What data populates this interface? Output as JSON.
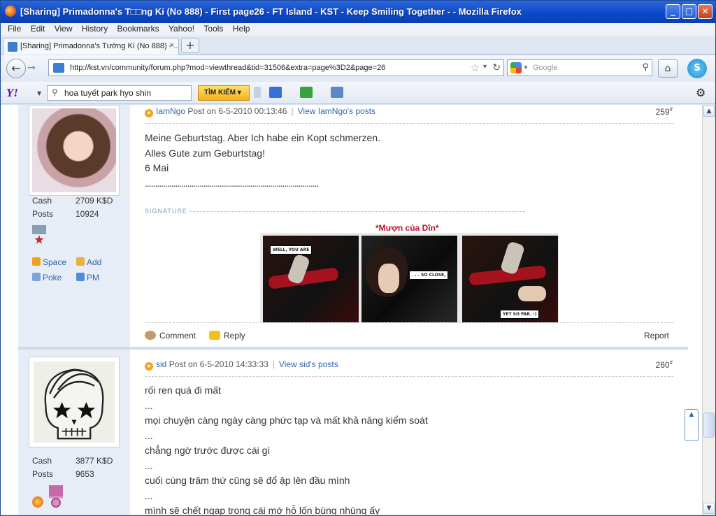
{
  "window": {
    "title": "[Sharing] Primadonna's T□□ng Kí (No 888) - First page26 - FT Island - KST - Keep Smiling Together - - Mozilla Firefox",
    "minimize": "_",
    "maximize": "□",
    "close": "✕"
  },
  "menu": [
    "File",
    "Edit",
    "View",
    "History",
    "Bookmarks",
    "Yahoo!",
    "Tools",
    "Help"
  ],
  "tab": {
    "label": "[Sharing] Primadonna's Tướng Kí (No 888) - ...",
    "close": "×"
  },
  "newtab": "+",
  "nav": {
    "url": "http://kst.vn/community/forum.php?mod=viewthread&tid=31506&extra=page%3D2&page=26",
    "search_placeholder": "Google"
  },
  "yahoo": {
    "logo": "Y!",
    "search_value": "hoa tuyết park hyo shin",
    "button": "TÌM KIẾM ▾"
  },
  "posts": [
    {
      "author": "IamNgo",
      "posted": "Post on 6-5-2010 00:13:46",
      "view_link": "View IamNgo's posts",
      "number": "259",
      "cash_label": "Cash",
      "cash": "2709 K$D",
      "posts_label": "Posts",
      "posts": "10924",
      "actions": [
        "Space",
        "Add",
        "Poke",
        "PM"
      ],
      "lines": [
        "Meine Geburtstag. Aber Ich habe ein Kopt schmerzen.",
        "Alles Gute zum Geburtstag!",
        "6 Mai",
        "......................................................................................"
      ],
      "signature_label": "SIGNATURE",
      "signature_title": "*Mượn của Dîn*",
      "comic": [
        "WELL, YOU ARE",
        ". . . SO CLOSE,",
        "YET SO FAR. :)"
      ],
      "footer": {
        "comment": "Comment",
        "reply": "Reply",
        "report": "Report"
      }
    },
    {
      "author": "sid",
      "posted": "Post on 6-5-2010 14:33:33",
      "view_link": "View sid's posts",
      "number": "260",
      "cash_label": "Cash",
      "cash": "3877 K$D",
      "posts_label": "Posts",
      "posts": "9653",
      "lines": [
        "rối ren quá đi mất",
        "...",
        "mọi chuyện càng ngày càng phức tạp và mất khả năng kiểm soát",
        "...",
        "chẳng ngờ trước được cái gì",
        "...",
        "cuối cùng trăm thứ cũng sẽ đổ ập lên đầu mình",
        "...",
        "mình sẽ chết ngạp trong cái mớ hỗ lốn bùng nhùng ấy"
      ]
    }
  ]
}
